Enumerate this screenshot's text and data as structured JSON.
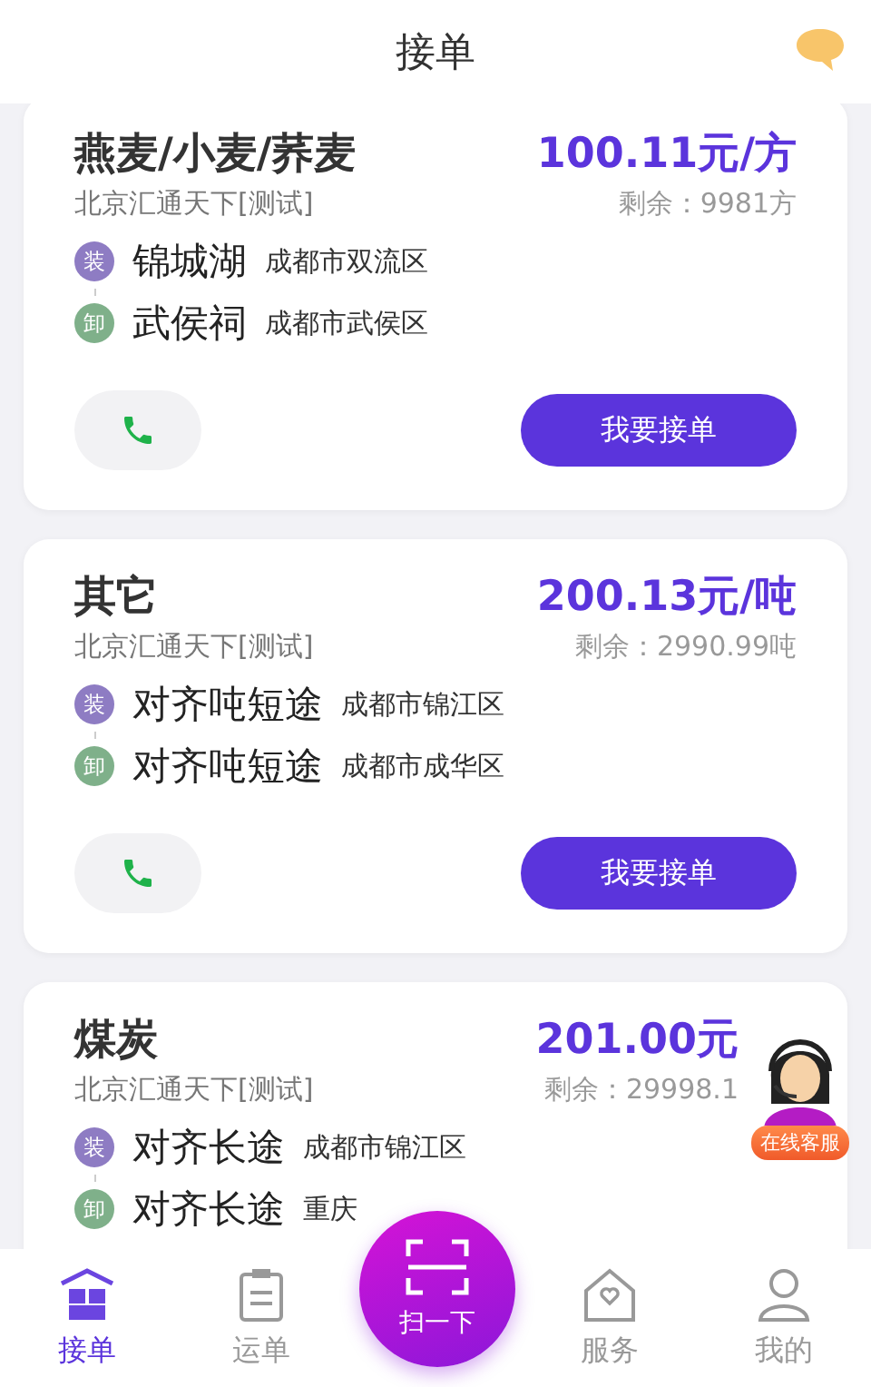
{
  "header": {
    "title": "接单"
  },
  "orders": [
    {
      "cargo": "燕麦/小麦/荞麦",
      "company": "北京汇通天下[测试]",
      "price": "100.11元/方",
      "remaining": "剩余：9981方",
      "stops": [
        {
          "kind": "load",
          "badge": "装",
          "place": "锦城湖",
          "address": "成都市双流区"
        },
        {
          "kind": "unload",
          "badge": "卸",
          "place": "武侯祠",
          "address": "成都市武侯区"
        }
      ],
      "action": "我要接单"
    },
    {
      "cargo": "其它",
      "company": "北京汇通天下[测试]",
      "price": "200.13元/吨",
      "remaining": "剩余：2990.99吨",
      "stops": [
        {
          "kind": "load",
          "badge": "装",
          "place": "对齐吨短途",
          "address": "成都市锦江区"
        },
        {
          "kind": "unload",
          "badge": "卸",
          "place": "对齐吨短途",
          "address": "成都市成华区"
        }
      ],
      "action": "我要接单"
    },
    {
      "cargo": "煤炭",
      "company": "北京汇通天下[测试]",
      "price": "201.00元",
      "remaining": "剩余：29998.1",
      "stops": [
        {
          "kind": "load",
          "badge": "装",
          "place": "对齐长途",
          "address": "成都市锦江区"
        },
        {
          "kind": "unload",
          "badge": "卸",
          "place": "对齐长途",
          "address": "重庆"
        }
      ]
    }
  ],
  "service": {
    "label": "在线客服"
  },
  "scan": {
    "label": "扫一下"
  },
  "tabs": [
    {
      "kind": "orders",
      "label": "接单",
      "selected": true
    },
    {
      "kind": "waybill",
      "label": "运单",
      "selected": false
    },
    {
      "kind": "gap"
    },
    {
      "kind": "service",
      "label": "服务",
      "selected": false
    },
    {
      "kind": "profile",
      "label": "我的",
      "selected": false
    }
  ]
}
